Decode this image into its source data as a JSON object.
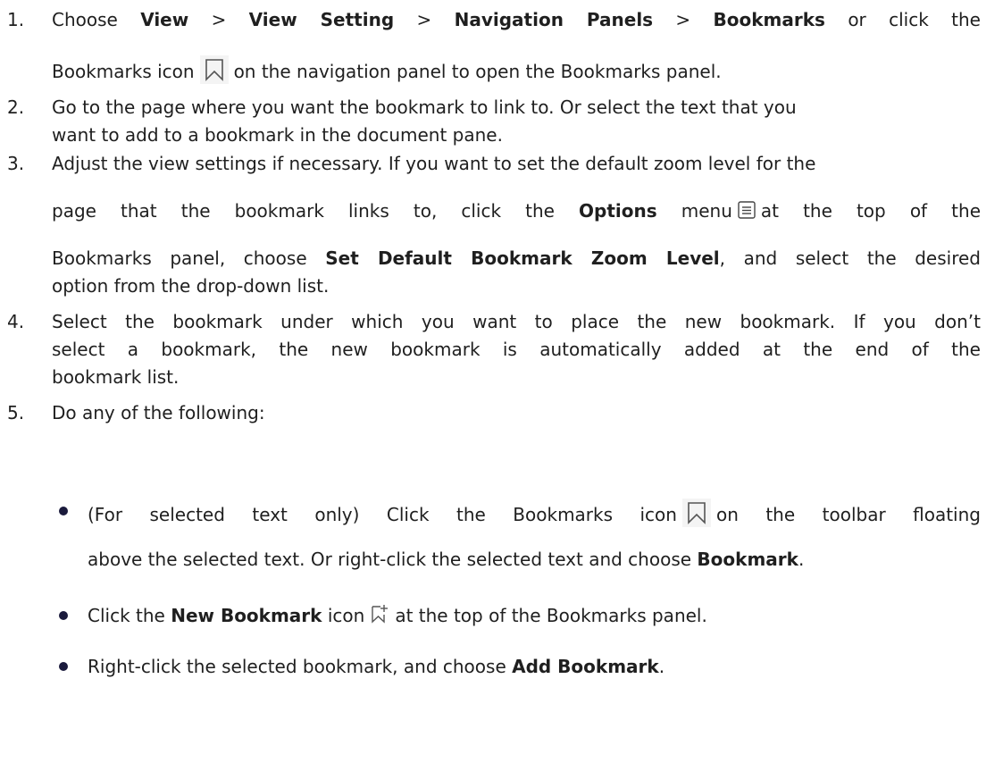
{
  "steps": [
    {
      "number": "1.",
      "line1": {
        "p1": "Choose ",
        "b1": "View",
        "p2": " > ",
        "b2": "View Setting",
        "p3": " > ",
        "b3": "Navigation Panels",
        "p4": " > ",
        "b4": "Bookmarks",
        "p5": " or click the"
      },
      "line2": {
        "p1": "Bookmarks icon",
        "icon": "bookmark-icon",
        "p2": "on the navigation panel to open the Bookmarks panel."
      }
    },
    {
      "number": "2.",
      "line1": "Go to the page where you want the bookmark to link to. Or select the text that you",
      "line2": "want to add to a bookmark in the document pane."
    },
    {
      "number": "3.",
      "line1": "Adjust the view settings if necessary. If you want to set the default zoom level for the",
      "line2": {
        "p1": "page that the bookmark links to, click the ",
        "b1": "Options",
        "p2": " menu",
        "icon": "options-menu-icon",
        "p3": "at the top of the"
      },
      "line3": {
        "p1": "Bookmarks panel, choose ",
        "b1": "Set Default Bookmark Zoom Level",
        "p2": ", and select the desired"
      },
      "line4": "option from the drop-down list."
    },
    {
      "number": "4.",
      "line1": "Select the bookmark under which you want to place the new bookmark. If you don’t",
      "line2": "select a bookmark, the new bookmark is automatically added at the end of the",
      "line3": "bookmark list."
    },
    {
      "number": "5.",
      "line1": "Do any of the following:"
    }
  ],
  "bullets": [
    {
      "line1": {
        "p1": "(For selected text only) Click the Bookmarks icon",
        "icon": "bookmark-icon",
        "p2": "on the toolbar floating"
      },
      "line2": {
        "p1": "above the selected text. Or right-click the selected text and choose ",
        "b1": "Bookmark",
        "p2": "."
      }
    },
    {
      "line1": {
        "p1": "Click the ",
        "b1": "New Bookmark",
        "p2": " icon",
        "icon": "new-bookmark-icon",
        "p3": "at the top of the Bookmarks panel."
      }
    },
    {
      "line1": {
        "p1": "Right-click the selected bookmark, and choose ",
        "b1": "Add Bookmark",
        "p2": "."
      }
    }
  ]
}
